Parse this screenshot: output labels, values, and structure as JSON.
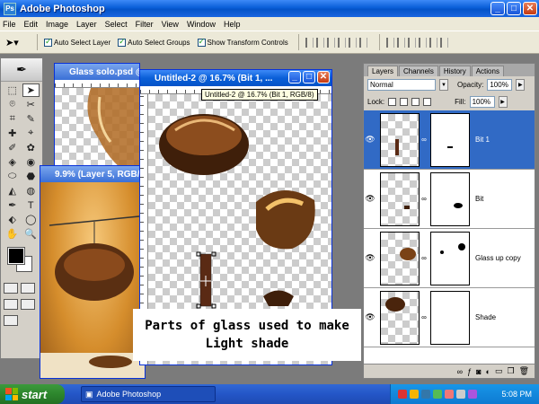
{
  "app": {
    "title": "Adobe Photoshop",
    "logo_text": "Ps",
    "window_buttons": {
      "minimize": "_",
      "maximize": "□",
      "close": "✕"
    }
  },
  "menu": [
    "File",
    "Edit",
    "Image",
    "Layer",
    "Select",
    "Filter",
    "View",
    "Window",
    "Help"
  ],
  "options": {
    "tool_icon": "move-tool-icon",
    "auto_select_layer": "Auto Select Layer",
    "auto_select_groups": "Auto Select Groups",
    "show_transform_controls": "Show Transform Controls"
  },
  "toolbox": {
    "header_icon": "feather-icon",
    "tools": [
      "⬚",
      "➤",
      "⌾",
      "✂",
      "⌗",
      "✎",
      "✚",
      "⌖",
      "✐",
      "✿",
      "◈",
      "◉",
      "⬭",
      "⬣",
      "◭",
      "◍",
      "✒",
      "T",
      "⬖",
      "◯",
      "✋",
      "🔍"
    ]
  },
  "docs": {
    "glass_solo": {
      "title": "Glass solo.psd @"
    },
    "layer5": {
      "title": "9.9% (Layer 5, RGB/8)"
    },
    "untitled": {
      "title": "Untitled-2 @ 16.7% (Bit 1, ...",
      "tooltip": "Untitled-2 @ 16.7% (Bit 1, RGB/8)"
    }
  },
  "caption": {
    "line1": "Parts of glass used to make",
    "line2": "Light shade"
  },
  "layers_panel": {
    "tabs": [
      "Layers",
      "Channels",
      "History",
      "Actions"
    ],
    "blend_mode": "Normal",
    "opacity_label": "Opacity:",
    "opacity_value": "100%",
    "lock_label": "Lock:",
    "fill_label": "Fill:",
    "fill_value": "100%",
    "layers": [
      {
        "name": "Bit 1",
        "selected": true
      },
      {
        "name": "Bit",
        "selected": false
      },
      {
        "name": "Glass up copy",
        "selected": false
      },
      {
        "name": "Shade",
        "selected": false
      }
    ]
  },
  "taskbar": {
    "start_label": "start",
    "task_label": "Adobe Photoshop",
    "clock": "5:08 PM"
  },
  "colors": {
    "foreground": "#000000",
    "background": "#ffffff",
    "selected_layer": "#316ac5"
  }
}
